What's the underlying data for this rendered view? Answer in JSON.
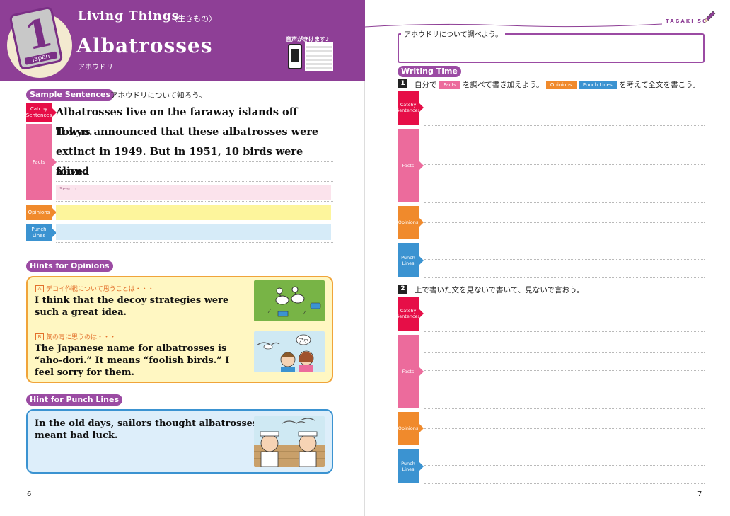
{
  "header": {
    "subject": "Living Things",
    "subject_jp": "〈生きもの〉",
    "unit_number": "1",
    "country": "Japan",
    "title": "Albatrosses",
    "title_jp": "アホウドリ",
    "audio_label": "音声がきけます♪"
  },
  "sample": {
    "label": "Sample Sentences",
    "label_jp": "アホウドリについて知ろう。",
    "tags": {
      "catchy": "Catchy Sentences",
      "facts": "Facts",
      "opinions": "Opinions",
      "punch": "Punch Lines"
    },
    "lines": [
      "Albatrosses live on the faraway islands off Tokyo.",
      "It was announced that these albatrosses were",
      "extinct in 1949. But in 1951, 10 birds were found",
      "alive."
    ],
    "search_placeholder": "Search"
  },
  "hints_opinions": {
    "label": "Hints for Opinions",
    "a_letter": "A",
    "a_prompt": "デコイ作戦について思うことは・・・",
    "a_text_1": "I think that the decoy strategies were",
    "a_text_2": "such a great idea.",
    "b_letter": "B",
    "b_prompt": "気の毒に思うのは・・・",
    "b_text_1": "The Japanese name for albatrosses is",
    "b_text_2": "“aho-dori.” It means “foolish birds.” I",
    "b_text_3": "feel sorry for them.",
    "speech": "アホ"
  },
  "hint_punch": {
    "label": "Hint for Punch Lines",
    "text_1": "In the old days, sailors thought albatrosses",
    "text_2": "meant bad luck."
  },
  "page_left": "6",
  "page_right": "7",
  "right": {
    "tagaki": "TAGAKI",
    "tagaki_num": "50",
    "research_label": "アホウドリについて調べよう。",
    "writing_label": "Writing Time",
    "step1_num": "1",
    "step1_a": "自分で",
    "step1_facts": "Facts",
    "step1_b": "を調べて書き加えよう。",
    "step1_opinions": "Opinions",
    "step1_punch": "Punch Lines",
    "step1_c": "を考えて全文を書こう。",
    "step2_num": "2",
    "step2_text": "上で書いた文を見ないで書いて、見ないで言おう。"
  },
  "colors": {
    "purple": "#8e3f96",
    "red": "#e60e47",
    "pink": "#ec6b9c",
    "orange": "#f08a2c",
    "blue": "#3b93d1"
  }
}
